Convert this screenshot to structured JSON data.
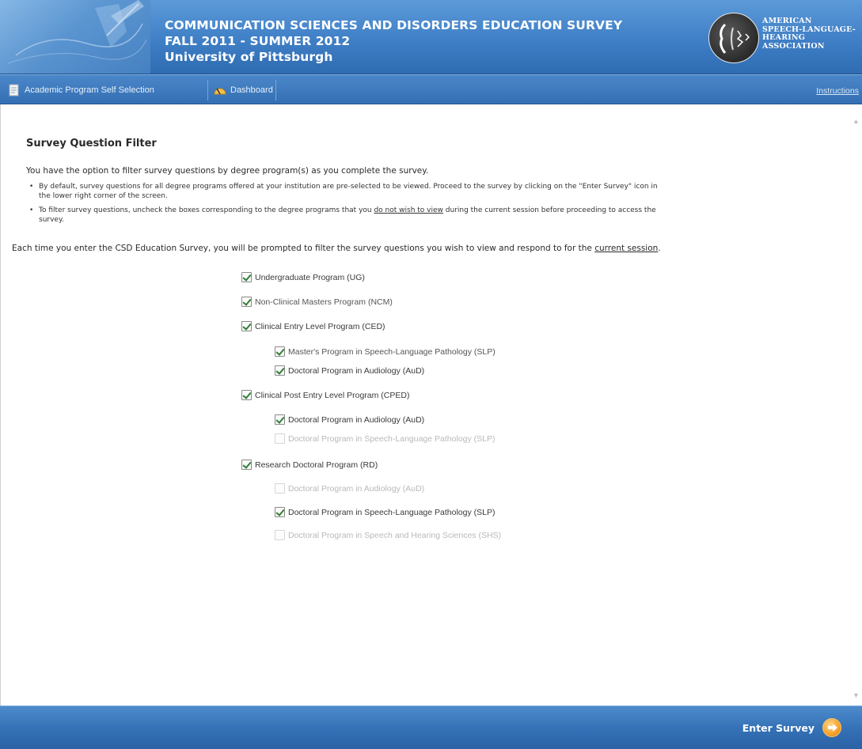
{
  "header": {
    "title_line1": "COMMUNICATION SCIENCES AND DISORDERS EDUCATION SURVEY",
    "title_line2": "FALL 2011 - SUMMER 2012",
    "title_line3": "University of Pittsburgh",
    "logo_line1": "American",
    "logo_line2": "Speech-Language-",
    "logo_line3": "Hearing",
    "logo_line4": "Association"
  },
  "nav": {
    "item1_label": "Academic Program Self Selection",
    "item1_icon": "document-icon",
    "item2_label": "Dashboard",
    "item2_icon": "gauge-icon",
    "instructions_label": "Instructions"
  },
  "main": {
    "section_title": "Survey Question Filter",
    "intro": "You have the option to filter survey questions by degree program(s) as you complete the survey.",
    "bullet1_line1": "By default, survey questions for all degree programs offered at your institution are pre-selected to be viewed. Proceed to the survey by clicking on the \"Enter Survey\" icon in",
    "bullet1_line2": "the lower right corner of the screen.",
    "bullet2_part1": "To filter survey questions, uncheck the boxes corresponding to the degree programs that you ",
    "bullet2_underlined": "do not wish to view",
    "bullet2_part2": " during the current session before proceeding to access the",
    "bullet2_line2": "survey.",
    "each_time_part1": "Each time you enter the CSD Education Survey, you will be prompted to filter the survey questions you wish to view and respond to for the ",
    "each_time_underlined": "current session",
    "each_time_part2": "."
  },
  "programs": [
    {
      "label": "Undergraduate Program (UG)",
      "checked": true,
      "enabled": true
    },
    {
      "label": "Non-Clinical Masters Program (NCM)",
      "checked": true,
      "enabled": true
    },
    {
      "label": "Clinical Entry Level Program (CED)",
      "checked": true,
      "enabled": true
    },
    {
      "label": "Master's Program in Speech-Language Pathology (SLP)",
      "checked": true,
      "enabled": true
    },
    {
      "label": "Doctoral Program in Audiology (AuD)",
      "checked": true,
      "enabled": true
    },
    {
      "label": "Clinical Post Entry Level Program (CPED)",
      "checked": true,
      "enabled": true
    },
    {
      "label": "Doctoral Program in Audiology (AuD)",
      "checked": true,
      "enabled": true
    },
    {
      "label": "Doctoral Program in Speech-Language Pathology (SLP)",
      "checked": false,
      "enabled": false
    },
    {
      "label": "Research Doctoral Program (RD)",
      "checked": true,
      "enabled": true
    },
    {
      "label": "Doctoral Program in Audiology (AuD)",
      "checked": false,
      "enabled": false
    },
    {
      "label": "Doctoral Program in Speech-Language Pathology (SLP)",
      "checked": true,
      "enabled": true
    },
    {
      "label": "Doctoral Program in Speech and Hearing Sciences (SHS)",
      "checked": false,
      "enabled": false
    }
  ],
  "footer": {
    "enter_label": "Enter Survey",
    "enter_icon": "arrow-right-circle-icon"
  },
  "colors": {
    "header_blue": "#3f7fc6",
    "accent_orange": "#f4a02a",
    "check_green": "#2f7d32"
  }
}
